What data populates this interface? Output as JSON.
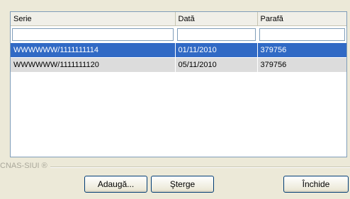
{
  "table": {
    "columns": [
      "Serie",
      "Dată",
      "Parafă"
    ],
    "rows": [
      {
        "serie": "WWWWWW/1111111114",
        "data": "01/11/2010",
        "parafa": "379756",
        "selected": true
      },
      {
        "serie": "WWWWWW/1111111120",
        "data": "05/11/2010",
        "parafa": "379756",
        "selected": false
      }
    ],
    "filters": {
      "serie": "",
      "data": "",
      "parafa": ""
    }
  },
  "group_label": "CNAS-SIUI ®",
  "buttons": {
    "add": "Adaugă...",
    "delete": "Şterge",
    "close": "Închide"
  },
  "colors": {
    "selection": "#316ac5",
    "row_alt": "#dcdcdc",
    "background": "#ece9d8"
  }
}
